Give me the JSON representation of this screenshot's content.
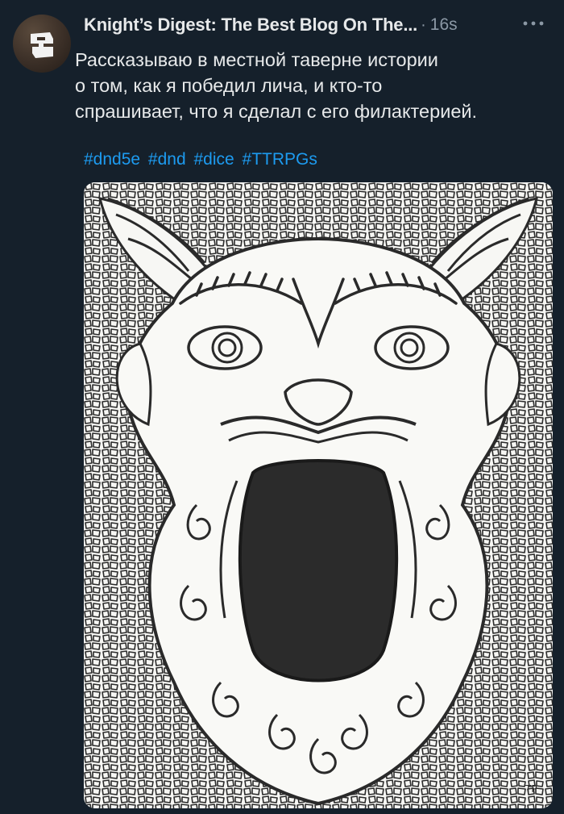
{
  "post": {
    "author_name": "Knight’s Digest: The Best Blog On The...",
    "separator": "·",
    "time": "16s",
    "text": "Рассказываю в местной таверне истории\nо том, как я победил лича, и кто-то\nспрашивает, что я сделал с его филактерией.",
    "hashtags": [
      "#dnd5e",
      "#dnd",
      "#dice",
      "#TTRPGs"
    ],
    "more_icon": "more-horizontal-icon",
    "avatar_icon": "knight-helmet-icon"
  },
  "image": {
    "description_icon": "screaming-demon-mask-illustration",
    "signature": "TP"
  },
  "colors": {
    "background": "#15202b",
    "text": "#e7e9ea",
    "muted": "#8b98a5",
    "link": "#1d9bf0",
    "image_bg": "#f7f7f4",
    "ink": "#2a2a2a"
  }
}
